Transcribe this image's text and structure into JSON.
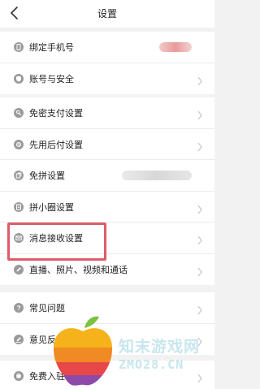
{
  "header": {
    "title": "设置"
  },
  "groups": [
    {
      "items": [
        {
          "label": "绑定手机号",
          "icon": "phone-icon"
        },
        {
          "label": "账号与安全",
          "icon": "shield-icon"
        }
      ]
    },
    {
      "items": [
        {
          "label": "免密支付设置",
          "icon": "key-icon"
        },
        {
          "label": "先用后付设置",
          "icon": "settings-icon"
        },
        {
          "label": "免拼设置",
          "icon": "copy-icon"
        },
        {
          "label": "拼小圈设置",
          "icon": "document-icon"
        },
        {
          "label": "消息接收设置",
          "icon": "mail-icon"
        },
        {
          "label": "直播、照片、视频和通话",
          "icon": "pencil-icon"
        }
      ]
    },
    {
      "items": [
        {
          "label": "常见问题",
          "icon": "question-icon"
        },
        {
          "label": "意见反馈",
          "icon": "edit-icon"
        }
      ]
    },
    {
      "items": [
        {
          "label": "免费入驻",
          "icon": "store-icon"
        }
      ]
    }
  ],
  "watermark": {
    "text_cn": "知末游戏网",
    "text_en": "ZMO28.CN"
  },
  "colors": {
    "highlight": "#e05a6a",
    "icon": "#9a9a9a",
    "background": "#f2f2f2"
  }
}
